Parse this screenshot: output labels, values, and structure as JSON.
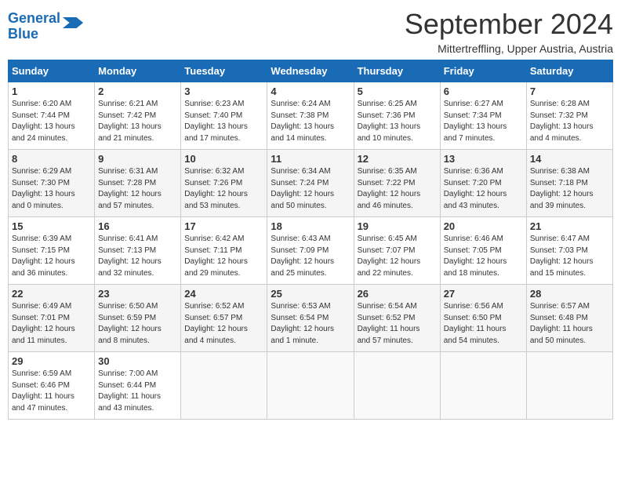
{
  "logo": {
    "line1": "General",
    "line2": "Blue"
  },
  "title": "September 2024",
  "subtitle": "Mittertreffling, Upper Austria, Austria",
  "weekdays": [
    "Sunday",
    "Monday",
    "Tuesday",
    "Wednesday",
    "Thursday",
    "Friday",
    "Saturday"
  ],
  "weeks": [
    [
      {
        "day": "1",
        "sunrise": "6:20 AM",
        "sunset": "7:44 PM",
        "daylight": "13 hours and 24 minutes."
      },
      {
        "day": "2",
        "sunrise": "6:21 AM",
        "sunset": "7:42 PM",
        "daylight": "13 hours and 21 minutes."
      },
      {
        "day": "3",
        "sunrise": "6:23 AM",
        "sunset": "7:40 PM",
        "daylight": "13 hours and 17 minutes."
      },
      {
        "day": "4",
        "sunrise": "6:24 AM",
        "sunset": "7:38 PM",
        "daylight": "13 hours and 14 minutes."
      },
      {
        "day": "5",
        "sunrise": "6:25 AM",
        "sunset": "7:36 PM",
        "daylight": "13 hours and 10 minutes."
      },
      {
        "day": "6",
        "sunrise": "6:27 AM",
        "sunset": "7:34 PM",
        "daylight": "13 hours and 7 minutes."
      },
      {
        "day": "7",
        "sunrise": "6:28 AM",
        "sunset": "7:32 PM",
        "daylight": "13 hours and 4 minutes."
      }
    ],
    [
      {
        "day": "8",
        "sunrise": "6:29 AM",
        "sunset": "7:30 PM",
        "daylight": "13 hours and 0 minutes."
      },
      {
        "day": "9",
        "sunrise": "6:31 AM",
        "sunset": "7:28 PM",
        "daylight": "12 hours and 57 minutes."
      },
      {
        "day": "10",
        "sunrise": "6:32 AM",
        "sunset": "7:26 PM",
        "daylight": "12 hours and 53 minutes."
      },
      {
        "day": "11",
        "sunrise": "6:34 AM",
        "sunset": "7:24 PM",
        "daylight": "12 hours and 50 minutes."
      },
      {
        "day": "12",
        "sunrise": "6:35 AM",
        "sunset": "7:22 PM",
        "daylight": "12 hours and 46 minutes."
      },
      {
        "day": "13",
        "sunrise": "6:36 AM",
        "sunset": "7:20 PM",
        "daylight": "12 hours and 43 minutes."
      },
      {
        "day": "14",
        "sunrise": "6:38 AM",
        "sunset": "7:18 PM",
        "daylight": "12 hours and 39 minutes."
      }
    ],
    [
      {
        "day": "15",
        "sunrise": "6:39 AM",
        "sunset": "7:15 PM",
        "daylight": "12 hours and 36 minutes."
      },
      {
        "day": "16",
        "sunrise": "6:41 AM",
        "sunset": "7:13 PM",
        "daylight": "12 hours and 32 minutes."
      },
      {
        "day": "17",
        "sunrise": "6:42 AM",
        "sunset": "7:11 PM",
        "daylight": "12 hours and 29 minutes."
      },
      {
        "day": "18",
        "sunrise": "6:43 AM",
        "sunset": "7:09 PM",
        "daylight": "12 hours and 25 minutes."
      },
      {
        "day": "19",
        "sunrise": "6:45 AM",
        "sunset": "7:07 PM",
        "daylight": "12 hours and 22 minutes."
      },
      {
        "day": "20",
        "sunrise": "6:46 AM",
        "sunset": "7:05 PM",
        "daylight": "12 hours and 18 minutes."
      },
      {
        "day": "21",
        "sunrise": "6:47 AM",
        "sunset": "7:03 PM",
        "daylight": "12 hours and 15 minutes."
      }
    ],
    [
      {
        "day": "22",
        "sunrise": "6:49 AM",
        "sunset": "7:01 PM",
        "daylight": "12 hours and 11 minutes."
      },
      {
        "day": "23",
        "sunrise": "6:50 AM",
        "sunset": "6:59 PM",
        "daylight": "12 hours and 8 minutes."
      },
      {
        "day": "24",
        "sunrise": "6:52 AM",
        "sunset": "6:57 PM",
        "daylight": "12 hours and 4 minutes."
      },
      {
        "day": "25",
        "sunrise": "6:53 AM",
        "sunset": "6:54 PM",
        "daylight": "12 hours and 1 minute."
      },
      {
        "day": "26",
        "sunrise": "6:54 AM",
        "sunset": "6:52 PM",
        "daylight": "11 hours and 57 minutes."
      },
      {
        "day": "27",
        "sunrise": "6:56 AM",
        "sunset": "6:50 PM",
        "daylight": "11 hours and 54 minutes."
      },
      {
        "day": "28",
        "sunrise": "6:57 AM",
        "sunset": "6:48 PM",
        "daylight": "11 hours and 50 minutes."
      }
    ],
    [
      {
        "day": "29",
        "sunrise": "6:59 AM",
        "sunset": "6:46 PM",
        "daylight": "11 hours and 47 minutes."
      },
      {
        "day": "30",
        "sunrise": "7:00 AM",
        "sunset": "6:44 PM",
        "daylight": "11 hours and 43 minutes."
      },
      null,
      null,
      null,
      null,
      null
    ]
  ]
}
